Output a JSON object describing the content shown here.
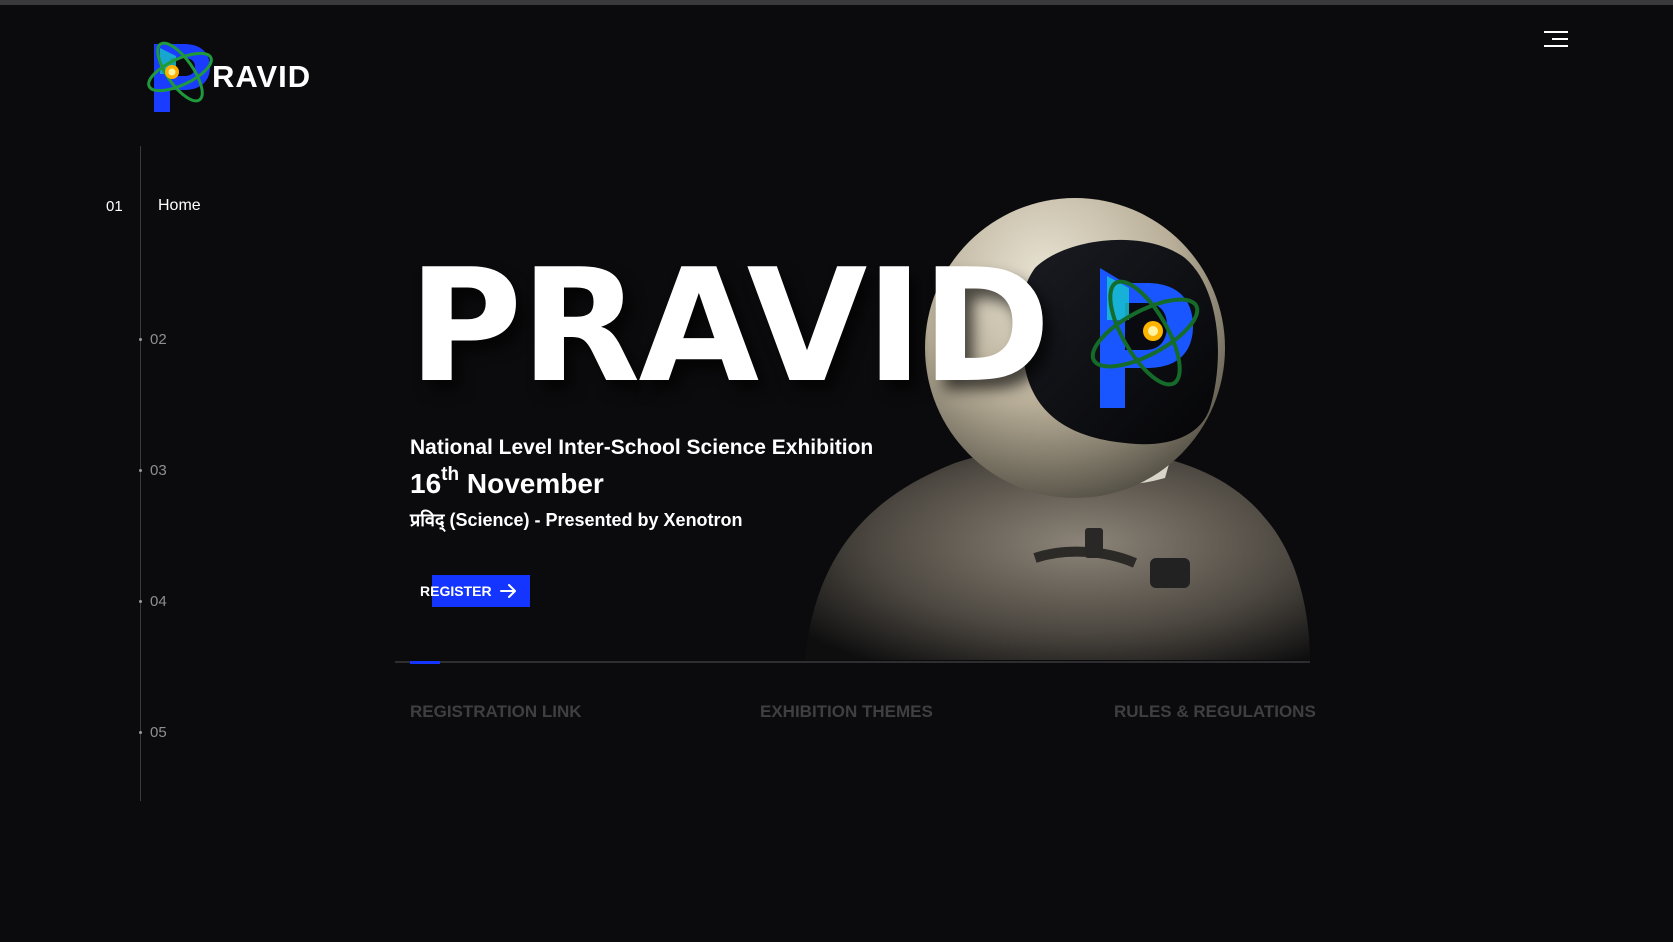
{
  "logo": {
    "text": "RAVID",
    "icon": "atom-p-logo-icon"
  },
  "menu": {
    "icon": "hamburger-menu-icon"
  },
  "side_nav": {
    "items": [
      {
        "number": "01",
        "label": "Home",
        "active": true
      },
      {
        "number": "02"
      },
      {
        "number": "03"
      },
      {
        "number": "04"
      },
      {
        "number": "05"
      }
    ]
  },
  "hero": {
    "title": "PRAVID",
    "subtitle": "National Level Inter-School Science Exhibition",
    "date_day": "16",
    "date_suffix": "th",
    "date_month": "November",
    "tagline": "प्रविद् (Science) - Presented by Xenotron",
    "register_label": "REGISTER",
    "image": "astronaut-with-logo-visor"
  },
  "slider": {
    "progress": 0.033
  },
  "tabs": [
    {
      "label": "REGISTRATION LINK"
    },
    {
      "label": "EXHIBITION THEMES"
    },
    {
      "label": "RULES & REGULATIONS"
    }
  ],
  "colors": {
    "background": "#0b0b0d",
    "accent": "#1434ff",
    "text": "#ffffff",
    "muted": "#3f3f42"
  }
}
